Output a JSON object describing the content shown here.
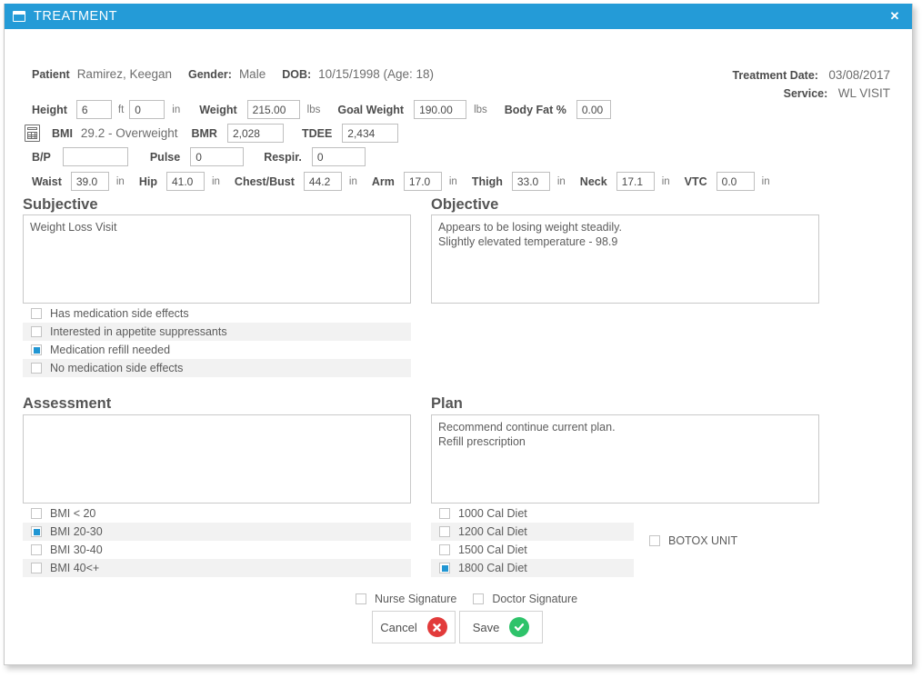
{
  "window": {
    "title": "TREATMENT",
    "title_icon": "window-icon",
    "close_label": "✕",
    "accent_color": "#249bd7"
  },
  "patient": {
    "patient_label": "Patient",
    "patient_name": "Ramirez, Keegan",
    "gender_label": "Gender:",
    "gender_value": "Male",
    "dob_label": "DOB:",
    "dob_value": "10/15/1998 (Age: 18)"
  },
  "meta": {
    "treatment_date_label": "Treatment Date:",
    "treatment_date_value": "03/08/2017",
    "service_label": "Service:",
    "service_value": "WL VISIT"
  },
  "vitals": {
    "height_label": "Height",
    "height_ft": "6",
    "ft_unit": "ft",
    "height_in": "0",
    "in_unit": "in",
    "weight_label": "Weight",
    "weight_value": "215.00",
    "weight_unit": "lbs",
    "goal_weight_label": "Goal Weight",
    "goal_weight_value": "190.00",
    "goal_weight_unit": "lbs",
    "body_fat_label": "Body Fat %",
    "body_fat_value": "0.00",
    "calculator_icon": "calculator-icon",
    "bmi_label": "BMI",
    "bmi_value": "29.2 - Overweight",
    "bmr_label": "BMR",
    "bmr_value": "2,028",
    "tdee_label": "TDEE",
    "tdee_value": "2,434",
    "bp_label": "B/P",
    "bp_value": "",
    "pulse_label": "Pulse",
    "pulse_value": "0",
    "respir_label": "Respir.",
    "respir_value": "0"
  },
  "measurements": {
    "unit": "in",
    "items": [
      {
        "label": "Waist",
        "value": "39.0"
      },
      {
        "label": "Hip",
        "value": "41.0"
      },
      {
        "label": "Chest/Bust",
        "value": "44.2"
      },
      {
        "label": "Arm",
        "value": "17.0"
      },
      {
        "label": "Thigh",
        "value": "33.0"
      },
      {
        "label": "Neck",
        "value": "17.1"
      },
      {
        "label": "VTC",
        "value": "0.0"
      }
    ]
  },
  "subjective": {
    "title": "Subjective",
    "text": "Weight Loss Visit",
    "options": [
      {
        "label": "Has medication side effects",
        "checked": false
      },
      {
        "label": "Interested in appetite suppressants",
        "checked": false
      },
      {
        "label": "Medication refill needed",
        "checked": true
      },
      {
        "label": "No medication side effects",
        "checked": false
      }
    ]
  },
  "objective": {
    "title": "Objective",
    "text": "Appears to be losing weight steadily.\nSlightly elevated temperature - 98.9"
  },
  "assessment": {
    "title": "Assessment",
    "text": "",
    "options": [
      {
        "label": "BMI < 20",
        "checked": false
      },
      {
        "label": "BMI 20-30",
        "checked": true
      },
      {
        "label": "BMI 30-40",
        "checked": false
      },
      {
        "label": "BMI 40<+",
        "checked": false
      }
    ]
  },
  "plan": {
    "title": "Plan",
    "text": "Recommend continue current plan.\nRefill prescription",
    "options": [
      {
        "label": "1000 Cal Diet",
        "checked": false
      },
      {
        "label": "1200 Cal Diet",
        "checked": false
      },
      {
        "label": "1500 Cal Diet",
        "checked": false
      },
      {
        "label": "1800 Cal Diet",
        "checked": true
      }
    ],
    "botox": {
      "label": "BOTOX UNIT",
      "checked": false
    }
  },
  "signatures": [
    {
      "label": "Nurse Signature",
      "checked": false
    },
    {
      "label": "Doctor Signature",
      "checked": false
    }
  ],
  "actions": {
    "cancel_label": "Cancel",
    "save_label": "Save",
    "cancel_color": "#e23b3b",
    "save_color": "#2ec36a"
  }
}
